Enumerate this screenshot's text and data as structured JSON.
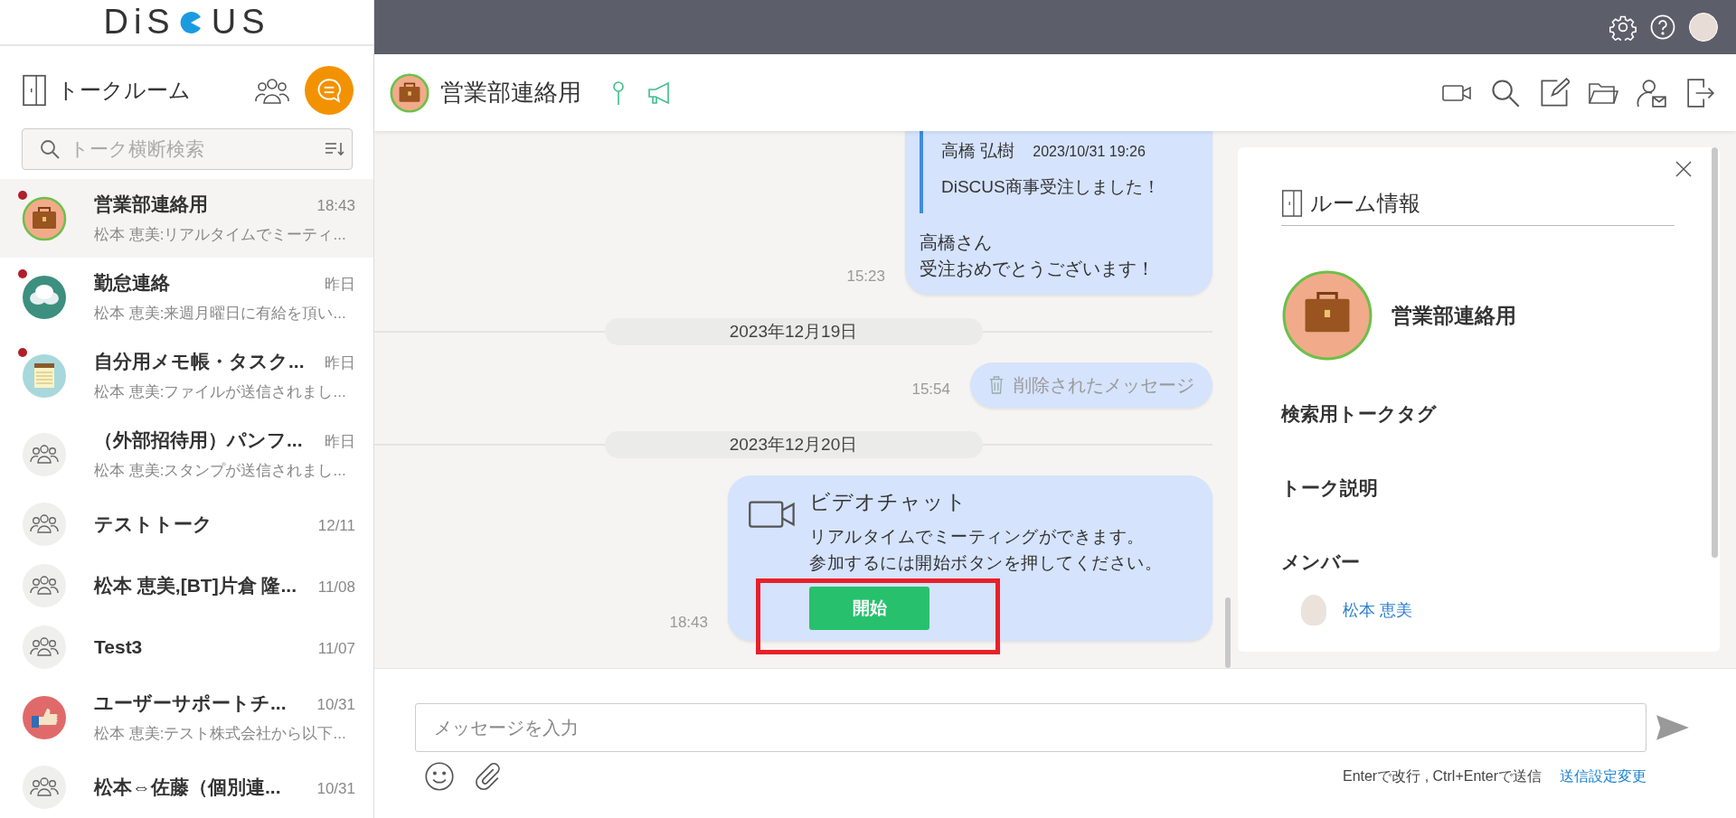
{
  "logo": {
    "before": "DiS",
    "after": "US"
  },
  "sidebar": {
    "title": "トークルーム",
    "search": {
      "placeholder": "トーク横断検索"
    },
    "rooms": [
      {
        "name": "営業部連絡用",
        "time": "18:43",
        "preview": "松本 恵美:リアルタイムでミーティ...",
        "kind": "briefcase",
        "unread": true,
        "selected": true
      },
      {
        "name": "勤怠連絡",
        "time": "昨日",
        "preview": "松本 恵美:来週月曜日に有給を頂い...",
        "kind": "chat",
        "unread": true,
        "selected": false
      },
      {
        "name": "自分用メモ帳・タスク...",
        "time": "昨日",
        "preview": "松本 恵美:ファイルが送信されまし...",
        "kind": "memo",
        "unread": true,
        "selected": false
      },
      {
        "name": "（外部招待用）パンフ...",
        "time": "昨日",
        "preview": "松本 恵美:スタンプが送信されまし...",
        "kind": "group",
        "unread": false,
        "selected": false
      },
      {
        "name": "テストトーク",
        "time": "12/11",
        "kind": "group",
        "unread": false,
        "selected": false
      },
      {
        "name": "松本 恵美,[BT]片倉 隆...",
        "time": "11/08",
        "kind": "group",
        "unread": false,
        "selected": false
      },
      {
        "name": "Test3",
        "time": "11/07",
        "kind": "group",
        "unread": false,
        "selected": false
      },
      {
        "name": "ユーザーサポートチ...",
        "time": "10/31",
        "preview": "松本 恵美:テスト株式会社から以下...",
        "kind": "thumbs",
        "unread": false,
        "selected": false
      },
      {
        "name": "松本⇔佐藤（個別連...",
        "time": "10/31",
        "kind": "group",
        "unread": false,
        "selected": false
      }
    ]
  },
  "room_header": {
    "name": "営業部連絡用"
  },
  "messages": [
    {
      "kind": "quote",
      "quote_author": "高橋 弘樹",
      "quote_time": "2023/10/31 19:26",
      "quote_text": "DiSCUS商事受注しました！",
      "lines": [
        "高橋さん",
        "受注おめでとうございます！"
      ],
      "time": "15:23"
    },
    {
      "kind": "date",
      "text": "2023年12月19日"
    },
    {
      "kind": "deleted",
      "text": "削除されたメッセージ",
      "time": "15:54"
    },
    {
      "kind": "date",
      "text": "2023年12月20日"
    },
    {
      "kind": "video",
      "title": "ビデオチャット",
      "lines": [
        "リアルタイムでミーティングができます。",
        "参加するには開始ボタンを押してください。"
      ],
      "button": "開始",
      "time": "18:43"
    }
  ],
  "room_info": {
    "title": "ルーム情報",
    "name": "営業部連絡用",
    "sections": [
      "検索用トークタグ",
      "トーク説明",
      "メンバー"
    ],
    "members": [
      {
        "name": "松本 恵美"
      }
    ]
  },
  "composer": {
    "placeholder": "メッセージを入力",
    "hint": "Enterで改行 , Ctrl+Enterで送信",
    "settings_link": "送信設定変更"
  }
}
